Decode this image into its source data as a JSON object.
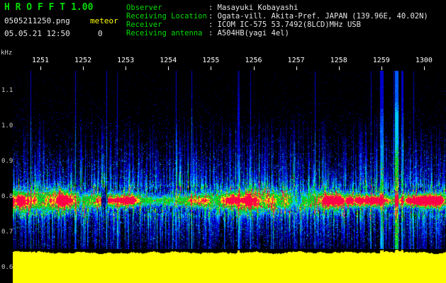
{
  "header": {
    "app_name": "H R O F F T",
    "version": "1.00",
    "filename": "0505211250.png",
    "mode": "meteor",
    "datetime": "05.05.21 12:50",
    "echo_count": "0",
    "info": [
      {
        "label": "Observer",
        "value": ": Masayuki Kobayashi"
      },
      {
        "label": "Receiving Location",
        "value": ": Ogata-vill. Akita-Pref. JAPAN (139.96E, 40.02N)"
      },
      {
        "label": "Receiver",
        "value": ": ICOM IC-575 53.7492(8LCD)MHz USB"
      },
      {
        "label": "Receiving antenna",
        "value": ": A504HB(yagi 4el)"
      }
    ]
  },
  "chart_data": {
    "type": "heatmap",
    "title": "HROFFT radio meteor observation spectrogram",
    "ylabel": "kHz",
    "y_ticks": [
      "1.1",
      "1.0",
      "0.9",
      "0.8",
      "0.7",
      "0.6"
    ],
    "y_range_khz": [
      0.65,
      1.16
    ],
    "x_ticks": [
      "1251",
      "1252",
      "1253",
      "1254",
      "1255",
      "1256",
      "1257",
      "1258",
      "1259",
      "1300"
    ],
    "x_axis": "time HHMM, 12:51 - 13:00",
    "carrier_band": {
      "center_khz": 0.79,
      "core_color": "#ff0046",
      "ring_colors": [
        "#fff000",
        "#00d228",
        "#00c8ff",
        "#0000cd",
        "#00006e"
      ],
      "description": "continuous carrier band with speckled colored fringes across the whole period"
    },
    "dropout_gap": {
      "between_x_ticks": [
        "1252",
        "1253"
      ],
      "description": "short black gap in the band"
    },
    "echo_streaks": {
      "near_x_tick": "1259",
      "description": "strong tall blue/cyan vertical streaks"
    },
    "noise": {
      "color": "#0000cd",
      "description": "dense vertical blue noise streaks above and below the band"
    },
    "background": "#000000",
    "level_strip": {
      "color": "#ffff00",
      "position": "bottom",
      "description": "signal level strip, nearly flat"
    }
  }
}
